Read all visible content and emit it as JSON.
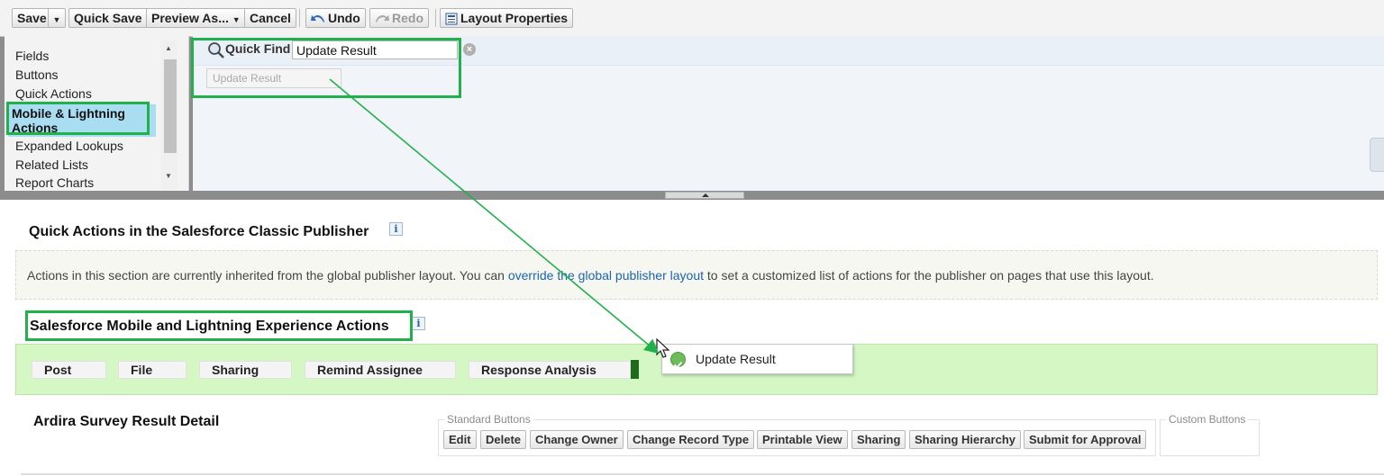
{
  "toolbar": {
    "save": "Save",
    "quick_save": "Quick Save",
    "preview_as": "Preview As...",
    "cancel": "Cancel",
    "undo": "Undo",
    "redo": "Redo",
    "layout_properties": "Layout Properties"
  },
  "palette": {
    "categories": [
      "Fields",
      "Buttons",
      "Quick Actions",
      "Mobile & Lightning Actions",
      "Expanded Lookups",
      "Related Lists",
      "Report Charts"
    ],
    "selected_category": "Mobile & Lightning Actions",
    "quick_find_label": "Quick Find",
    "quick_find_value": "Update Result",
    "items": [
      "Update Result"
    ]
  },
  "publisher": {
    "title": "Quick Actions in the Salesforce Classic Publisher",
    "info_glyph": "i",
    "text_before": "Actions in this section are currently inherited from the global publisher layout. You can ",
    "link_text": "override the global publisher layout",
    "text_after": " to set a customized list of actions for the publisher on pages that use this layout."
  },
  "mobile_actions": {
    "title": "Salesforce Mobile and Lightning Experience Actions",
    "info_glyph": "i",
    "actions": [
      "Post",
      "File",
      "Sharing",
      "Remind Assignee",
      "Response Analysis"
    ],
    "dragging_item": "Update Result"
  },
  "detail": {
    "title": "Ardira Survey Result Detail",
    "standard_buttons_legend": "Standard Buttons",
    "custom_buttons_legend": "Custom Buttons",
    "standard_buttons": [
      "Edit",
      "Delete",
      "Change Owner",
      "Change Record Type",
      "Printable View",
      "Sharing",
      "Sharing Hierarchy",
      "Submit for Approval"
    ]
  },
  "colors": {
    "highlight": "#22b04b",
    "actions_background": "#d5f7c4",
    "link": "#1a64b2",
    "selected_category": "#a9def2"
  },
  "icons": [
    "dropdown-arrow-icon",
    "undo-icon",
    "redo-icon",
    "layout-properties-icon",
    "magnifier-icon",
    "clear-icon",
    "check-icon",
    "cursor-icon",
    "info-icon"
  ]
}
